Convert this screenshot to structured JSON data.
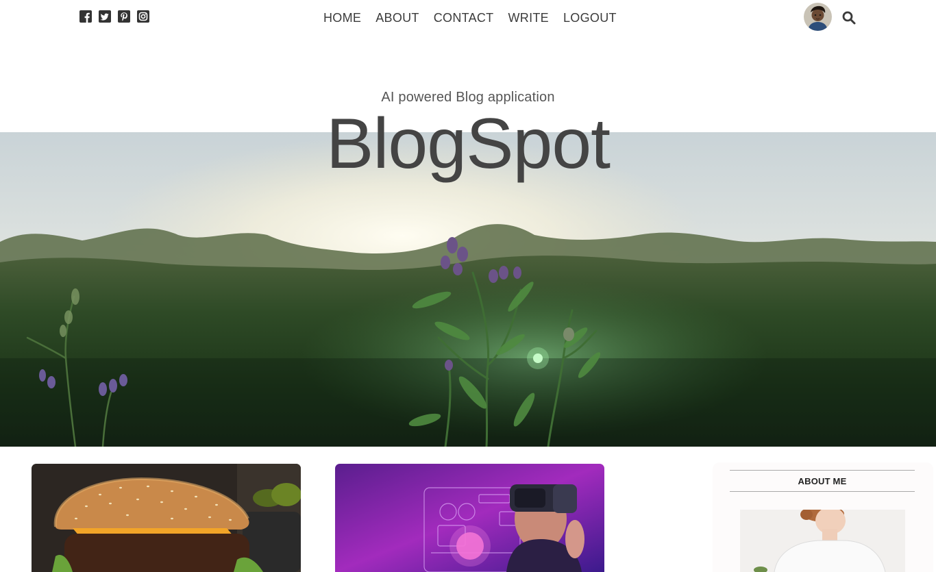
{
  "social": {
    "items": [
      {
        "name": "facebook-icon"
      },
      {
        "name": "twitter-icon"
      },
      {
        "name": "pinterest-icon"
      },
      {
        "name": "instagram-icon"
      }
    ]
  },
  "nav": {
    "items": [
      {
        "label": "HOME"
      },
      {
        "label": "ABOUT"
      },
      {
        "label": "CONTACT"
      },
      {
        "label": "WRITE"
      },
      {
        "label": "LOGOUT"
      }
    ]
  },
  "header": {
    "subtitle": "AI powered Blog application",
    "title": "BlogSpot"
  },
  "sidebar": {
    "title": "ABOUT ME"
  },
  "colors": {
    "text": "#444444",
    "icon": "#333333",
    "sidebar_bg": "#fdfbfb"
  }
}
